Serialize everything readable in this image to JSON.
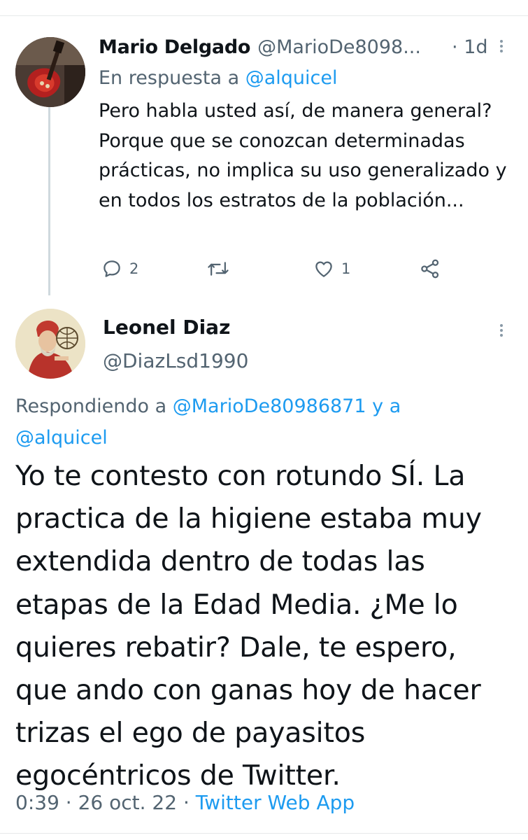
{
  "reply_tweet": {
    "author_name": "Mario Delgado",
    "author_handle": "@MarioDe8098...",
    "time_sep": "·",
    "time": "1d",
    "reply_prefix": "En respuesta a",
    "reply_to": "@alquicel",
    "text": "Pero habla usted así, de manera general? Porque que se conozcan determinadas prácticas, no implica su uso generalizado y en todos los estratos de la población...",
    "replies_count": "2",
    "likes_count": "1"
  },
  "main_tweet": {
    "author_name": "Leonel Diaz",
    "author_handle": "@DiazLsd1990",
    "reply_prefix": "Respondiendo a",
    "reply_to_1": "@MarioDe80986871",
    "reply_joiner": "y a",
    "reply_to_2": "@alquicel",
    "text": "Yo te contesto con rotundo SÍ. La practica de la higiene estaba muy extendida dentro de todas las etapas de la Edad Media. ¿Me lo quieres rebatir? Dale, te espero, que ando con ganas hoy de hacer trizas el ego de payasitos egocéntricos de Twitter.",
    "timestamp": "0:39 · 26 oct. 22 ·",
    "source": "Twitter Web App"
  },
  "colors": {
    "link": "#1d9bf0",
    "secondary_text": "#536471",
    "text": "#0f1419"
  },
  "icons": [
    "reply-icon",
    "retweet-icon",
    "like-icon",
    "share-icon",
    "more-icon"
  ]
}
